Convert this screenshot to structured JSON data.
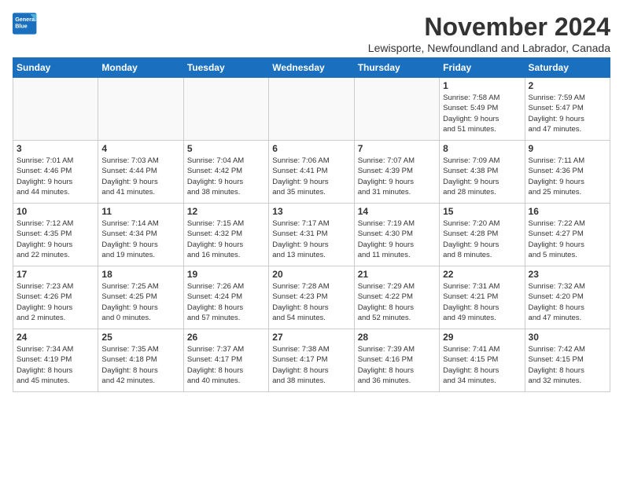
{
  "logo": {
    "line1": "General",
    "line2": "Blue"
  },
  "title": "November 2024",
  "location": "Lewisporte, Newfoundland and Labrador, Canada",
  "weekdays": [
    "Sunday",
    "Monday",
    "Tuesday",
    "Wednesday",
    "Thursday",
    "Friday",
    "Saturday"
  ],
  "weeks": [
    [
      {
        "day": "",
        "info": ""
      },
      {
        "day": "",
        "info": ""
      },
      {
        "day": "",
        "info": ""
      },
      {
        "day": "",
        "info": ""
      },
      {
        "day": "",
        "info": ""
      },
      {
        "day": "1",
        "info": "Sunrise: 7:58 AM\nSunset: 5:49 PM\nDaylight: 9 hours\nand 51 minutes."
      },
      {
        "day": "2",
        "info": "Sunrise: 7:59 AM\nSunset: 5:47 PM\nDaylight: 9 hours\nand 47 minutes."
      }
    ],
    [
      {
        "day": "3",
        "info": "Sunrise: 7:01 AM\nSunset: 4:46 PM\nDaylight: 9 hours\nand 44 minutes."
      },
      {
        "day": "4",
        "info": "Sunrise: 7:03 AM\nSunset: 4:44 PM\nDaylight: 9 hours\nand 41 minutes."
      },
      {
        "day": "5",
        "info": "Sunrise: 7:04 AM\nSunset: 4:42 PM\nDaylight: 9 hours\nand 38 minutes."
      },
      {
        "day": "6",
        "info": "Sunrise: 7:06 AM\nSunset: 4:41 PM\nDaylight: 9 hours\nand 35 minutes."
      },
      {
        "day": "7",
        "info": "Sunrise: 7:07 AM\nSunset: 4:39 PM\nDaylight: 9 hours\nand 31 minutes."
      },
      {
        "day": "8",
        "info": "Sunrise: 7:09 AM\nSunset: 4:38 PM\nDaylight: 9 hours\nand 28 minutes."
      },
      {
        "day": "9",
        "info": "Sunrise: 7:11 AM\nSunset: 4:36 PM\nDaylight: 9 hours\nand 25 minutes."
      }
    ],
    [
      {
        "day": "10",
        "info": "Sunrise: 7:12 AM\nSunset: 4:35 PM\nDaylight: 9 hours\nand 22 minutes."
      },
      {
        "day": "11",
        "info": "Sunrise: 7:14 AM\nSunset: 4:34 PM\nDaylight: 9 hours\nand 19 minutes."
      },
      {
        "day": "12",
        "info": "Sunrise: 7:15 AM\nSunset: 4:32 PM\nDaylight: 9 hours\nand 16 minutes."
      },
      {
        "day": "13",
        "info": "Sunrise: 7:17 AM\nSunset: 4:31 PM\nDaylight: 9 hours\nand 13 minutes."
      },
      {
        "day": "14",
        "info": "Sunrise: 7:19 AM\nSunset: 4:30 PM\nDaylight: 9 hours\nand 11 minutes."
      },
      {
        "day": "15",
        "info": "Sunrise: 7:20 AM\nSunset: 4:28 PM\nDaylight: 9 hours\nand 8 minutes."
      },
      {
        "day": "16",
        "info": "Sunrise: 7:22 AM\nSunset: 4:27 PM\nDaylight: 9 hours\nand 5 minutes."
      }
    ],
    [
      {
        "day": "17",
        "info": "Sunrise: 7:23 AM\nSunset: 4:26 PM\nDaylight: 9 hours\nand 2 minutes."
      },
      {
        "day": "18",
        "info": "Sunrise: 7:25 AM\nSunset: 4:25 PM\nDaylight: 9 hours\nand 0 minutes."
      },
      {
        "day": "19",
        "info": "Sunrise: 7:26 AM\nSunset: 4:24 PM\nDaylight: 8 hours\nand 57 minutes."
      },
      {
        "day": "20",
        "info": "Sunrise: 7:28 AM\nSunset: 4:23 PM\nDaylight: 8 hours\nand 54 minutes."
      },
      {
        "day": "21",
        "info": "Sunrise: 7:29 AM\nSunset: 4:22 PM\nDaylight: 8 hours\nand 52 minutes."
      },
      {
        "day": "22",
        "info": "Sunrise: 7:31 AM\nSunset: 4:21 PM\nDaylight: 8 hours\nand 49 minutes."
      },
      {
        "day": "23",
        "info": "Sunrise: 7:32 AM\nSunset: 4:20 PM\nDaylight: 8 hours\nand 47 minutes."
      }
    ],
    [
      {
        "day": "24",
        "info": "Sunrise: 7:34 AM\nSunset: 4:19 PM\nDaylight: 8 hours\nand 45 minutes."
      },
      {
        "day": "25",
        "info": "Sunrise: 7:35 AM\nSunset: 4:18 PM\nDaylight: 8 hours\nand 42 minutes."
      },
      {
        "day": "26",
        "info": "Sunrise: 7:37 AM\nSunset: 4:17 PM\nDaylight: 8 hours\nand 40 minutes."
      },
      {
        "day": "27",
        "info": "Sunrise: 7:38 AM\nSunset: 4:17 PM\nDaylight: 8 hours\nand 38 minutes."
      },
      {
        "day": "28",
        "info": "Sunrise: 7:39 AM\nSunset: 4:16 PM\nDaylight: 8 hours\nand 36 minutes."
      },
      {
        "day": "29",
        "info": "Sunrise: 7:41 AM\nSunset: 4:15 PM\nDaylight: 8 hours\nand 34 minutes."
      },
      {
        "day": "30",
        "info": "Sunrise: 7:42 AM\nSunset: 4:15 PM\nDaylight: 8 hours\nand 32 minutes."
      }
    ]
  ]
}
